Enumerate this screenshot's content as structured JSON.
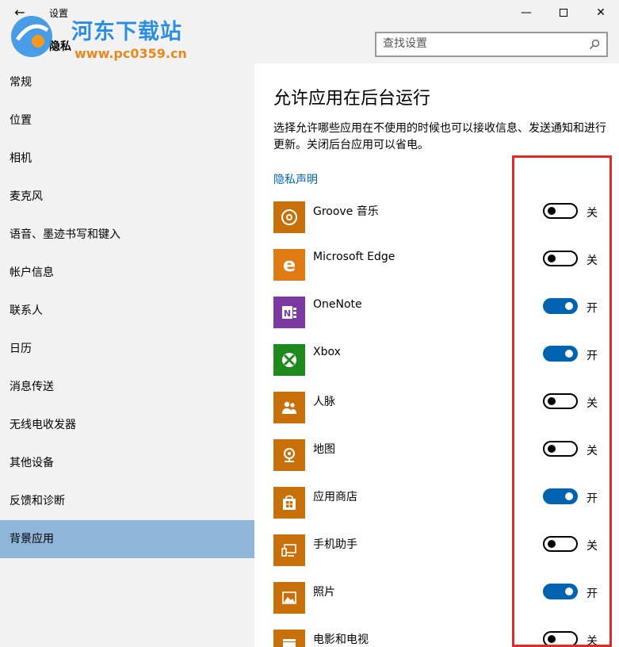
{
  "window": {
    "title": "设置",
    "section": "隐私",
    "back_glyph": "←",
    "min_glyph": "—",
    "close_glyph": "✕"
  },
  "search": {
    "placeholder": "查找设置"
  },
  "watermark": {
    "name": "河东下载站",
    "url": "www.pc0359.cn"
  },
  "sidebar": {
    "items": [
      {
        "label": "常规",
        "active": false
      },
      {
        "label": "位置",
        "active": false
      },
      {
        "label": "相机",
        "active": false
      },
      {
        "label": "麦克风",
        "active": false
      },
      {
        "label": "语音、墨迹书写和键入",
        "active": false
      },
      {
        "label": "帐户信息",
        "active": false
      },
      {
        "label": "联系人",
        "active": false
      },
      {
        "label": "日历",
        "active": false
      },
      {
        "label": "消息传送",
        "active": false
      },
      {
        "label": "无线电收发器",
        "active": false
      },
      {
        "label": "其他设备",
        "active": false
      },
      {
        "label": "反馈和诊断",
        "active": false
      },
      {
        "label": "背景应用",
        "active": true
      }
    ]
  },
  "main": {
    "heading": "允许应用在后台运行",
    "description": "选择允许哪些应用在不使用的时候也可以接收信息、发送通知和进行更新。关闭后台应用可以省电。",
    "privacy_link": "隐私声明",
    "apps": [
      {
        "name": "Groove 音乐",
        "on": false,
        "state_label": "关",
        "icon": "groove-music-icon",
        "color": "#c8700a"
      },
      {
        "name": "Microsoft Edge",
        "on": false,
        "state_label": "关",
        "icon": "edge-icon",
        "color": "#e07a12"
      },
      {
        "name": "OneNote",
        "on": true,
        "state_label": "开",
        "icon": "onenote-icon",
        "color": "#7b3aa0"
      },
      {
        "name": "Xbox",
        "on": true,
        "state_label": "开",
        "icon": "xbox-icon",
        "color": "#1e8a1e"
      },
      {
        "name": "人脉",
        "on": false,
        "state_label": "关",
        "icon": "people-icon",
        "color": "#c8700a"
      },
      {
        "name": "地图",
        "on": false,
        "state_label": "关",
        "icon": "maps-icon",
        "color": "#c8700a"
      },
      {
        "name": "应用商店",
        "on": true,
        "state_label": "开",
        "icon": "store-icon",
        "color": "#c8700a"
      },
      {
        "name": "手机助手",
        "on": false,
        "state_label": "关",
        "icon": "phone-companion-icon",
        "color": "#c8700a"
      },
      {
        "name": "照片",
        "on": true,
        "state_label": "开",
        "icon": "photos-icon",
        "color": "#c8700a"
      },
      {
        "name": "电影和电视",
        "on": false,
        "state_label": "关",
        "icon": "movies-tv-icon",
        "color": "#c8700a"
      }
    ]
  },
  "colors": {
    "accent": "#0063b1",
    "sidebar_bg": "#f2f2f2",
    "sidebar_active": "#8fb5d9",
    "annotation": "#e02a2a"
  }
}
